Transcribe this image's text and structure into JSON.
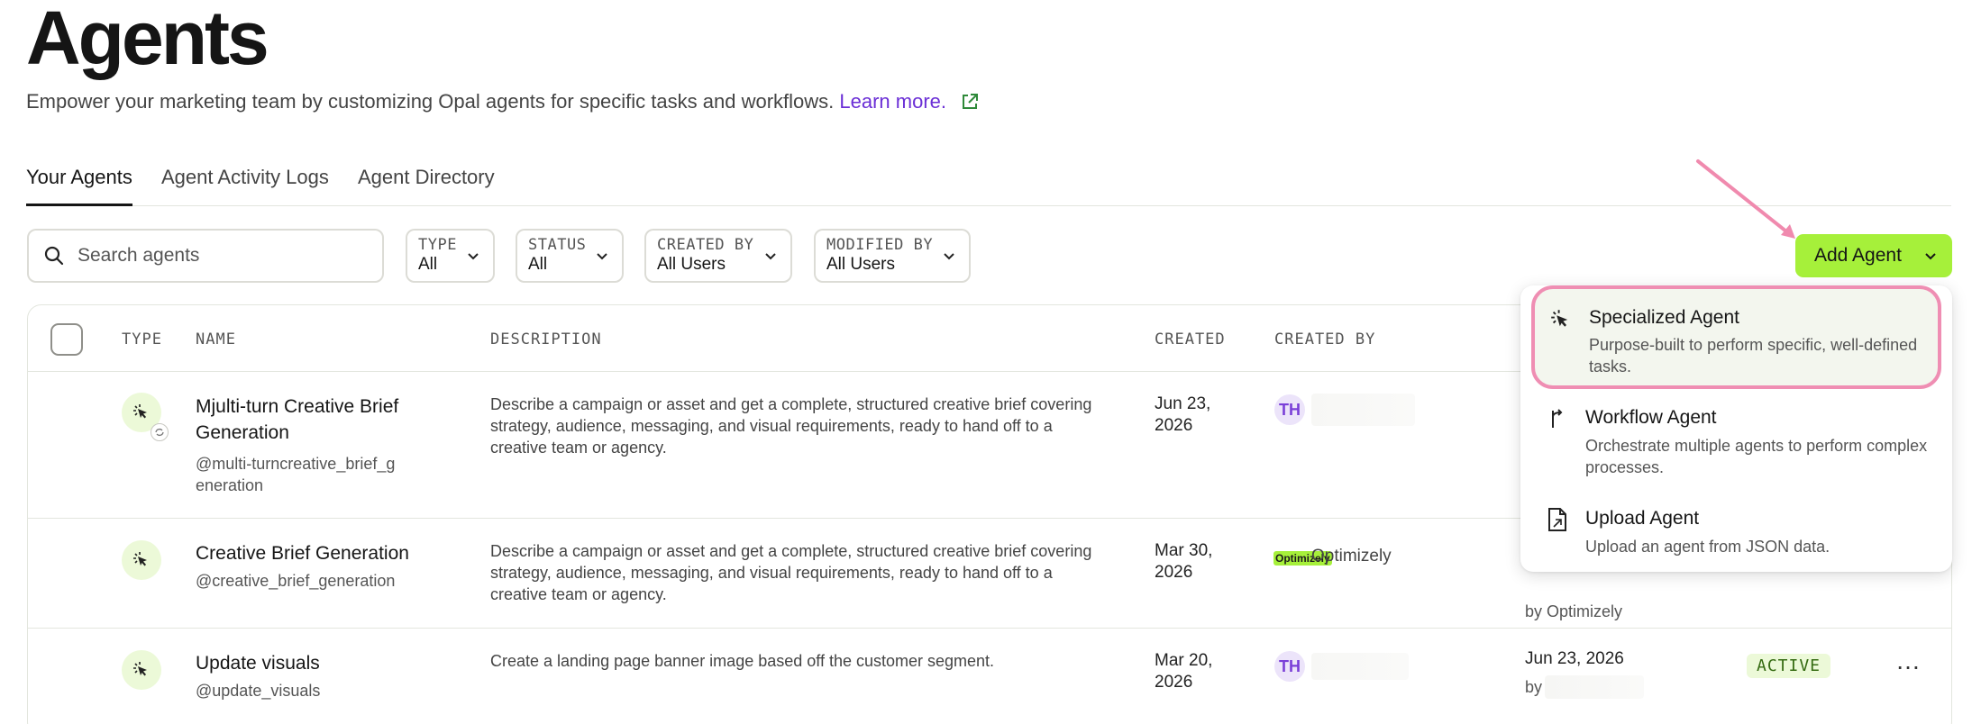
{
  "page": {
    "title": "Agents",
    "subtitle": "Empower your marketing team by customizing Opal agents for specific tasks and workflows.",
    "learn_more": "Learn more."
  },
  "tabs": [
    {
      "label": "Your Agents",
      "active": true
    },
    {
      "label": "Agent Activity Logs",
      "active": false
    },
    {
      "label": "Agent Directory",
      "active": false
    }
  ],
  "search": {
    "placeholder": "Search agents"
  },
  "filters": [
    {
      "label": "TYPE",
      "value": "All"
    },
    {
      "label": "STATUS",
      "value": "All"
    },
    {
      "label": "CREATED BY",
      "value": "All Users"
    },
    {
      "label": "MODIFIED BY",
      "value": "All Users"
    }
  ],
  "add_agent": {
    "label": "Add Agent",
    "color": "#a6f03a"
  },
  "table": {
    "headers": {
      "type": "TYPE",
      "name": "NAME",
      "description": "DESCRIPTION",
      "created": "CREATED",
      "created_by": "CREATED BY"
    },
    "rows": [
      {
        "name": "Mjulti-turn Creative Brief Generation",
        "handle": "@multi-turncreative_brief_generation",
        "description": "Describe a campaign or asset and get a complete, structured creative brief covering strategy, audience, messaging, and visual requirements, ready to hand off to a creative team or agency.",
        "created": "Jun 23, 2026",
        "created_by_initials": "TH"
      },
      {
        "name": "Creative Brief Generation",
        "handle": "@creative_brief_generation",
        "description": "Describe a campaign or asset and get a complete, structured creative brief covering strategy, audience, messaging, and visual requirements, ready to hand off to a creative team or agency.",
        "created": "Mar 30, 2026",
        "created_by_logo": "Optimizely",
        "created_by_name": "Optimizely",
        "modified_by": "by Optimizely"
      },
      {
        "name": "Update visuals",
        "handle": "@update_visuals",
        "description": "Create a landing page banner image based off the customer segment.",
        "created": "Mar 20, 2026",
        "created_by_initials": "TH",
        "modified": "Jun 23, 2026",
        "modified_by": "by",
        "status": "ACTIVE",
        "more": "…"
      }
    ]
  },
  "dropdown": {
    "items": [
      {
        "icon": "specialized-agent-icon",
        "title": "Specialized Agent",
        "description": "Purpose-built to perform specific, well-defined tasks.",
        "highlighted": true
      },
      {
        "icon": "workflow-agent-icon",
        "title": "Workflow Agent",
        "description": "Orchestrate multiple agents to perform complex processes."
      },
      {
        "icon": "upload-agent-icon",
        "title": "Upload Agent",
        "description": "Upload an agent from JSON data."
      }
    ]
  }
}
